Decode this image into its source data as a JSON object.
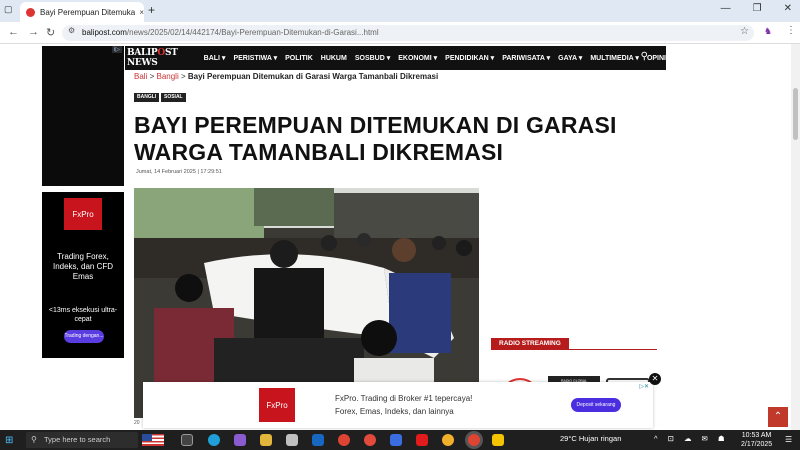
{
  "browser": {
    "tab_title": "Bayi Perempuan Ditemukan di G",
    "tab_close": "×",
    "new_tab": "+",
    "url_host": "balipost.com",
    "url_path": "/news/2025/02/14/442174/Bayi-Perempuan-Ditemukan-di-Garasi...html",
    "window_controls": [
      "—",
      "❐",
      "✕"
    ]
  },
  "icons": {
    "back": "back-arrow-icon",
    "forward": "forward-arrow-icon",
    "reload": "reload-icon",
    "star": "bookmark-star-icon",
    "menu": "kebab-menu-icon",
    "search": "search-icon"
  },
  "colors": {
    "brand_red": "#c8141c",
    "nav_bg": "#111111",
    "radio_red": "#b71c1c",
    "taskbar": "#1f1f1f"
  },
  "ads": {
    "left_top_tag": "i▷",
    "left_fx": {
      "brand": "FxPro",
      "line1": "Trading Forex, Indeks, dan CFD Emas",
      "line2": "<13ms eksekusi ultra-cepat",
      "cta": "Trading dengan..."
    },
    "bottom": {
      "brand": "FxPro",
      "line1": "FxPro. Trading di Broker #1 tepercaya!",
      "line2": "Forex, Emas, Indeks, dan lainnya",
      "cta": "Deposit sekarang",
      "close": "✕"
    }
  },
  "site": {
    "logo_a": "BALIP",
    "logo_o": "O",
    "logo_b": "ST",
    "logo_suffix": "NEWS",
    "nav": [
      "BALI ▾",
      "PERISTIWA ▾",
      "POLITIK",
      "HUKUM",
      "SOSBUD ▾",
      "EKONOMI ▾",
      "PENDIDIKAN ▾",
      "PARIWISATA ▾",
      "GAYA ▾",
      "MULTIMEDIA ▾",
      "OPINI"
    ]
  },
  "article": {
    "crumb_1": "Bali",
    "crumb_2": "Bangli",
    "crumb_sep": ">",
    "crumb_current": "Bayi Perempuan Ditemukan di Garasi Warga Tamanbali Dikremasi",
    "categories": [
      "BANGLI",
      "SOSIAL"
    ],
    "headline": "BAYI PEREMPUAN DITEMUKAN DI GARASI WARGA TAMANBALI DIKREMASI",
    "date": "Jumat, 14 Februari 2025 | 17:29:51"
  },
  "sidebar": {
    "radio_title": "RADIO STREAMING",
    "radio_label": "RADIO GLOBAL"
  },
  "taskbar": {
    "search_placeholder": "Type here to search",
    "weather": "29°C  Hujan ringan",
    "tray": "^ ⊡ ☁ ✉ ☗",
    "time": "10:53 AM",
    "date": "2/17/2025"
  }
}
